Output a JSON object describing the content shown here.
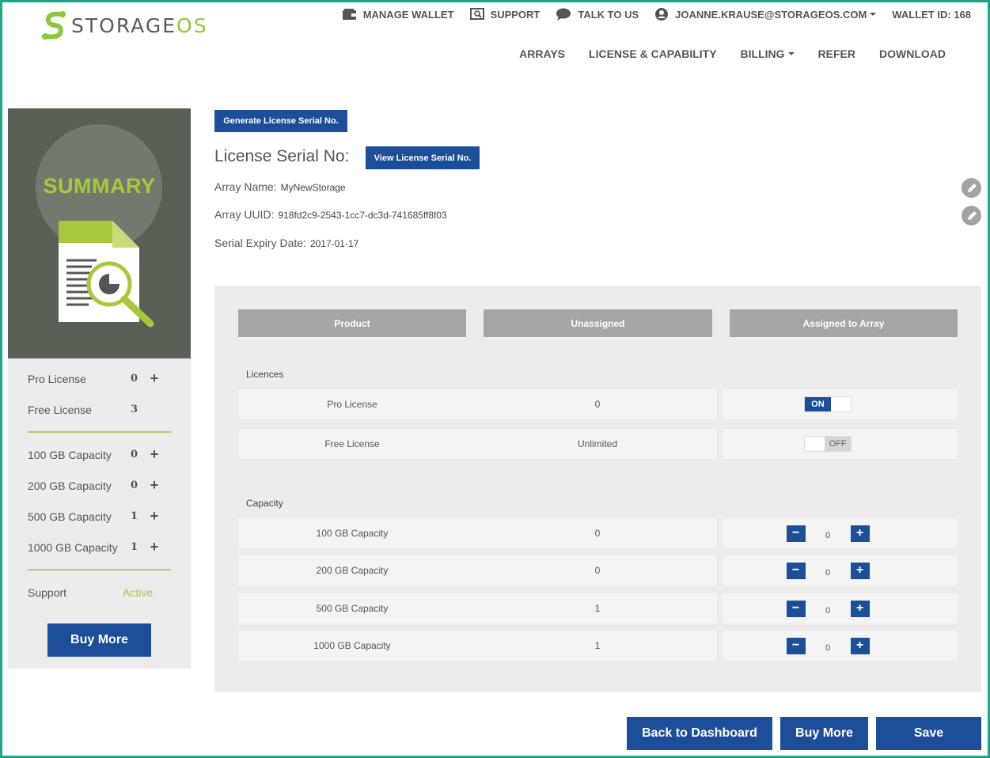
{
  "brand": {
    "name_main": "STORAGE",
    "name_accent": "OS"
  },
  "topbar": {
    "manage_wallet": "MANAGE WALLET",
    "support": "SUPPORT",
    "talk": "TALK TO US",
    "user": "JOANNE.KRAUSE@STORAGEOS.COM",
    "wallet_id": "WALLET ID: 168"
  },
  "nav": {
    "arrays": "ARRAYS",
    "license": "LICENSE & CAPABILITY",
    "billing": "BILLING",
    "refer": "REFER",
    "download": "DOWNLOAD"
  },
  "sidebar": {
    "title": "SUMMARY",
    "licenses": [
      {
        "label": "Pro License",
        "value": "0",
        "plus": "+"
      },
      {
        "label": "Free License",
        "value": "3",
        "plus": ""
      }
    ],
    "capacities": [
      {
        "label": "100 GB Capacity",
        "value": "0",
        "plus": "+"
      },
      {
        "label": "200 GB Capacity",
        "value": "0",
        "plus": "+"
      },
      {
        "label": "500 GB Capacity",
        "value": "1",
        "plus": "+"
      },
      {
        "label": "1000 GB Capacity",
        "value": "1",
        "plus": "+"
      }
    ],
    "support_label": "Support",
    "support_status": "Active",
    "buy_more": "Buy More"
  },
  "license_info": {
    "generate_btn": "Generate License Serial No.",
    "serial_label": "License Serial No:",
    "view_btn": "View License Serial No.",
    "array_name_label": "Array Name:",
    "array_name": "MyNewStorage",
    "array_uuid_label": "Array UUID:",
    "array_uuid": "918fd2c9-2543-1cc7-dc3d-741685ff8f03",
    "expiry_label": "Serial Expiry Date:",
    "expiry": "2017-01-17"
  },
  "table": {
    "headers": [
      "Product",
      "Unassigned",
      "Assigned to Array"
    ],
    "licences_label": "Licences",
    "licences": [
      {
        "product": "Pro License",
        "unassigned": "0",
        "toggle": "ON"
      },
      {
        "product": "Free License",
        "unassigned": "Unlimited",
        "toggle": "OFF"
      }
    ],
    "capacity_label": "Capacity",
    "capacity": [
      {
        "product": "100 GB Capacity",
        "unassigned": "0",
        "assigned": "0"
      },
      {
        "product": "200 GB Capacity",
        "unassigned": "0",
        "assigned": "0"
      },
      {
        "product": "500 GB Capacity",
        "unassigned": "1",
        "assigned": "0"
      },
      {
        "product": "1000 GB Capacity",
        "unassigned": "1",
        "assigned": "0"
      }
    ],
    "minus": "−",
    "plus": "+"
  },
  "footer": {
    "back": "Back to Dashboard",
    "buy_more": "Buy More",
    "save": "Save"
  },
  "colors": {
    "primary": "#1d4e99",
    "accent": "#8cc63f",
    "frame": "#1aa88a",
    "sidebar_hero": "#5a5f56"
  }
}
